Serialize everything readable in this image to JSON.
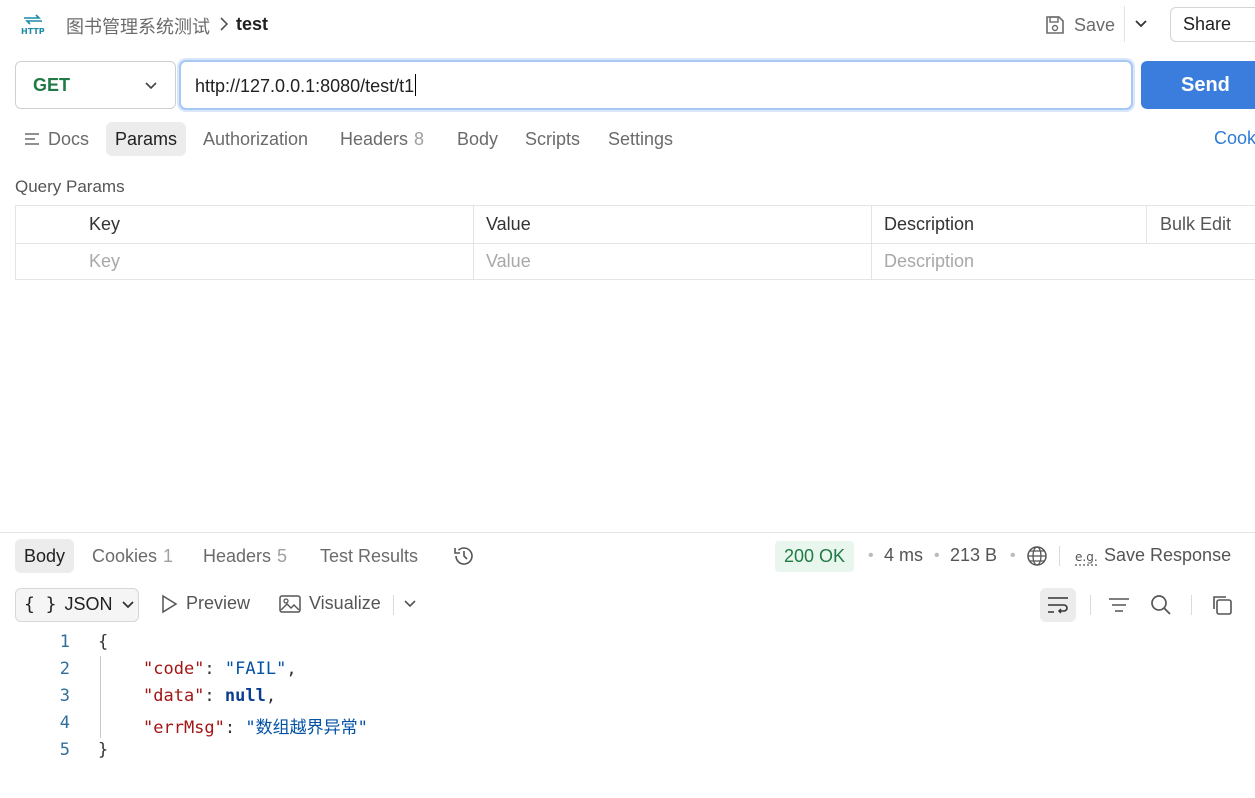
{
  "header": {
    "collection": "图书管理系统测试",
    "request_name": "test",
    "save_label": "Save",
    "share_label": "Share"
  },
  "request": {
    "method": "GET",
    "url": "http://127.0.0.1:8080/test/t1",
    "send_label": "Send"
  },
  "request_tabs": {
    "docs": "Docs",
    "params": "Params",
    "authorization": "Authorization",
    "headers": "Headers",
    "headers_count": "8",
    "body": "Body",
    "scripts": "Scripts",
    "settings": "Settings",
    "cookies": "Cook"
  },
  "params": {
    "section_label": "Query Params",
    "columns": [
      "Key",
      "Value",
      "Description"
    ],
    "bulk_edit": "Bulk Edit",
    "placeholders": [
      "Key",
      "Value",
      "Description"
    ]
  },
  "response_tabs": {
    "body": "Body",
    "cookies": "Cookies",
    "cookies_count": "1",
    "headers": "Headers",
    "headers_count": "5",
    "test_results": "Test Results"
  },
  "response_meta": {
    "status": "200 OK",
    "time": "4 ms",
    "size": "213 B",
    "save_response": "Save Response",
    "status_color": "#207a45"
  },
  "format_bar": {
    "format": "JSON",
    "preview": "Preview",
    "visualize": "Visualize"
  },
  "code": {
    "line_numbers": [
      "1",
      "2",
      "3",
      "4",
      "5"
    ],
    "open_brace": "{",
    "close_brace": "}",
    "lines": [
      {
        "key": "\"code\"",
        "value": "\"FAIL\"",
        "type": "string"
      },
      {
        "key": "\"data\"",
        "value": "null",
        "type": "null"
      },
      {
        "key": "\"errMsg\"",
        "value": "\"数组越界异常\"",
        "type": "string"
      }
    ]
  },
  "colors": {
    "accent": "#3b7ddd",
    "method_get": "#207a45"
  }
}
